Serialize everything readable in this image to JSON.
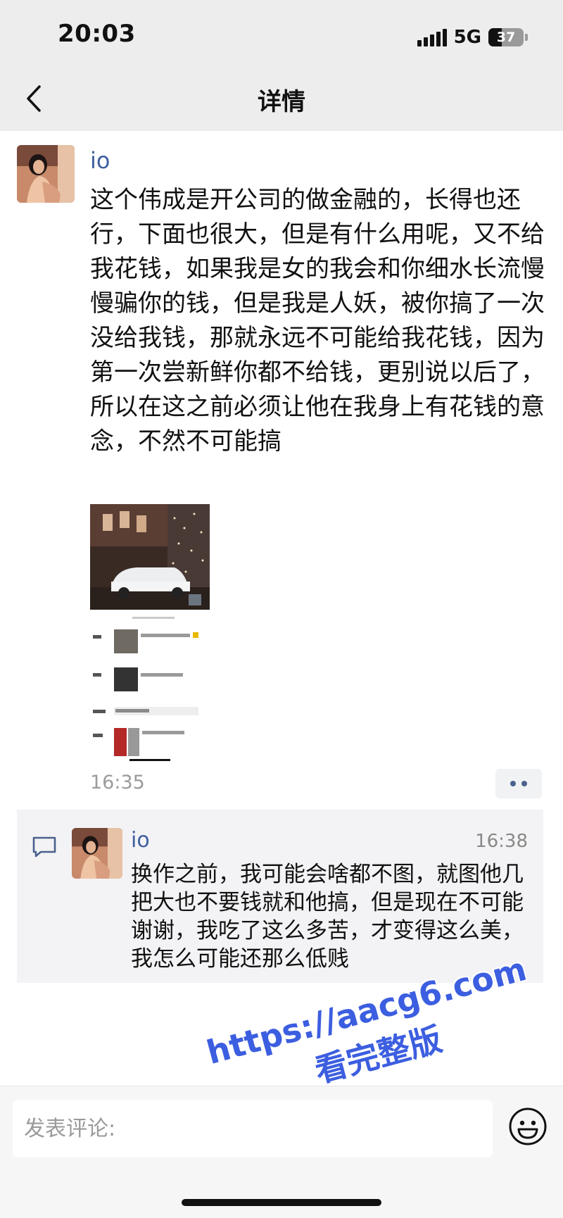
{
  "status_bar": {
    "time": "20:03",
    "network": "5G",
    "battery": "37",
    "battery_level": 0.37
  },
  "nav": {
    "title": "详情"
  },
  "post": {
    "author": "io",
    "text": "这个伟成是开公司的做金融的，长得也还行，下面也很大，但是有什么用呢，又不给我花钱，如果我是女的我会和你细水长流慢慢骗你的钱，但是我是人妖，被你搞了一次没给我钱，那就永远不可能给我花钱，因为第一次尝新鲜你都不给钱，更别说以后了，所以在这之前必须让他在我身上有花钱的意念，不然不可能搞",
    "time": "16:35"
  },
  "comment": {
    "author": "io",
    "time": "16:38",
    "text": "换作之前，我可能会啥都不图，就图他几把大也不要钱就和他搞，但是现在不可能谢谢，我吃了这么多苦，才变得这么美，我怎么可能还那么低贱"
  },
  "input": {
    "placeholder": "发表评论:"
  },
  "watermark": {
    "url": "https://aacg6.com",
    "sub": "看完整版"
  }
}
